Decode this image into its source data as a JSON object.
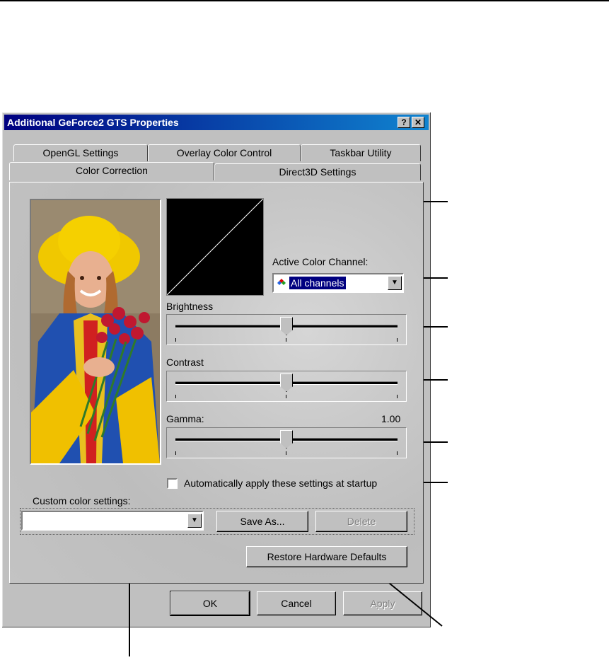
{
  "window": {
    "title": "Additional GeForce2 GTS Properties",
    "help_glyph": "?",
    "close_glyph": "✕"
  },
  "tabs": {
    "row1": [
      "OpenGL Settings",
      "Overlay Color Control",
      "Taskbar Utility"
    ],
    "row2": [
      "Color Correction",
      "Direct3D Settings"
    ],
    "active": "Color Correction"
  },
  "color_correction": {
    "active_channel_label": "Active Color Channel:",
    "active_channel_value": "All channels",
    "channel_icon": "rgb-channels-icon",
    "brightness_label": "Brightness",
    "contrast_label": "Contrast",
    "gamma_label": "Gamma:",
    "gamma_value": "1.00",
    "brightness_level": 0.5,
    "contrast_level": 0.5,
    "gamma_level": 0.5,
    "auto_apply_label": "Automatically apply these settings at startup",
    "auto_apply_checked": false,
    "custom_settings_label": "Custom color settings:",
    "custom_settings_value": "",
    "save_as_label": "Save As...",
    "delete_label": "Delete",
    "restore_label": "Restore Hardware Defaults"
  },
  "footer": {
    "ok_label": "OK",
    "cancel_label": "Cancel",
    "apply_label": "Apply"
  },
  "colors": {
    "title_start": "#000080",
    "title_end": "#1084d0",
    "face": "#c0c0c0"
  }
}
